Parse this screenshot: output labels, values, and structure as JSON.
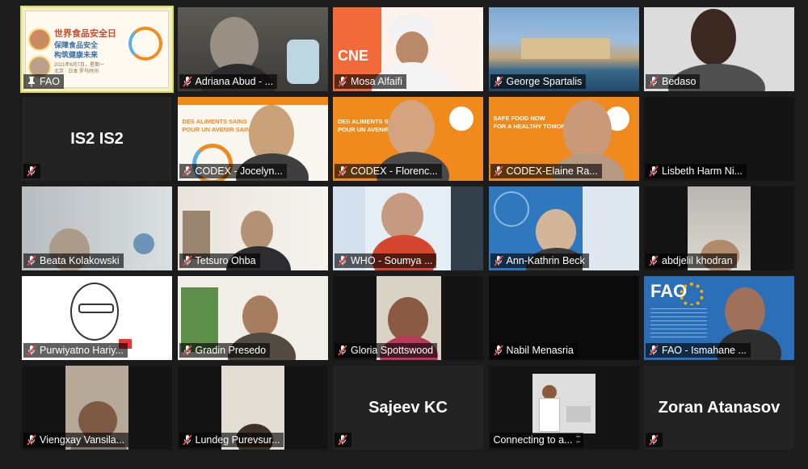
{
  "participants": [
    {
      "name": "FAO",
      "muted": false,
      "pinned": true,
      "active": true
    },
    {
      "name": "Adriana Abud - ...",
      "muted": true
    },
    {
      "name": "Mosa Alfaifi",
      "muted": true
    },
    {
      "name": "George Spartalis",
      "muted": true
    },
    {
      "name": "Bedaso",
      "muted": true
    },
    {
      "name": "",
      "big_name": "IS2 IS2",
      "muted": true
    },
    {
      "name": "CODEX - Jocelyn...",
      "muted": true
    },
    {
      "name": "CODEX - Florenc...",
      "muted": true
    },
    {
      "name": "CODEX-Elaine Ra...",
      "muted": true
    },
    {
      "name": "Lisbeth Harm Ni...",
      "muted": true
    },
    {
      "name": "Beata Kolakowski",
      "muted": true
    },
    {
      "name": "Tetsuro Ohba",
      "muted": true
    },
    {
      "name": "WHO - Soumya ...",
      "muted": true
    },
    {
      "name": "Ann-Kathrin Beck",
      "muted": true
    },
    {
      "name": "abdjelil khodran",
      "muted": true
    },
    {
      "name": "Purwiyatno Hariy...",
      "muted": true
    },
    {
      "name": "Gradin Presedo",
      "muted": true
    },
    {
      "name": "Gloria Spottswood",
      "muted": true
    },
    {
      "name": "Nabil Menasria",
      "muted": true
    },
    {
      "name": "FAO - Ismahane ...",
      "muted": true
    },
    {
      "name": "Viengxay Vansila...",
      "muted": true
    },
    {
      "name": "Lundeg Purevsur...",
      "muted": true
    },
    {
      "name": "",
      "big_name": "Sajeev KC",
      "muted": true
    },
    {
      "name": "Connecting to a...",
      "muted": false,
      "connecting": true
    },
    {
      "name": "",
      "big_name": "Zoran Atanasov",
      "muted": true
    }
  ],
  "fao_slide": {
    "title_cn": "世界食品安全日",
    "line1_cn": "保障食品安全",
    "line2_cn": "构筑健康未来",
    "date_cn": "2021年6月7日，星期一",
    "time_cn": "北京 · 日本 罗马时间"
  },
  "codex_slide": {
    "fr_line1": "DES ALIMENTS SAINS",
    "fr_line2": "POUR UN AVENIR SAIN",
    "en_line1": "SAFE FOOD NOW",
    "en_line2": "FOR A HEALTHY TOMORROW"
  },
  "mosa_slide_text": "CNE",
  "fao_ismahane_logo": "FAO",
  "colors": {
    "background": "#1c1c1c",
    "tile": "#232323",
    "active_border": "#d8e244",
    "mute_red": "#e8484e",
    "codex_orange": "#f08a1c"
  }
}
